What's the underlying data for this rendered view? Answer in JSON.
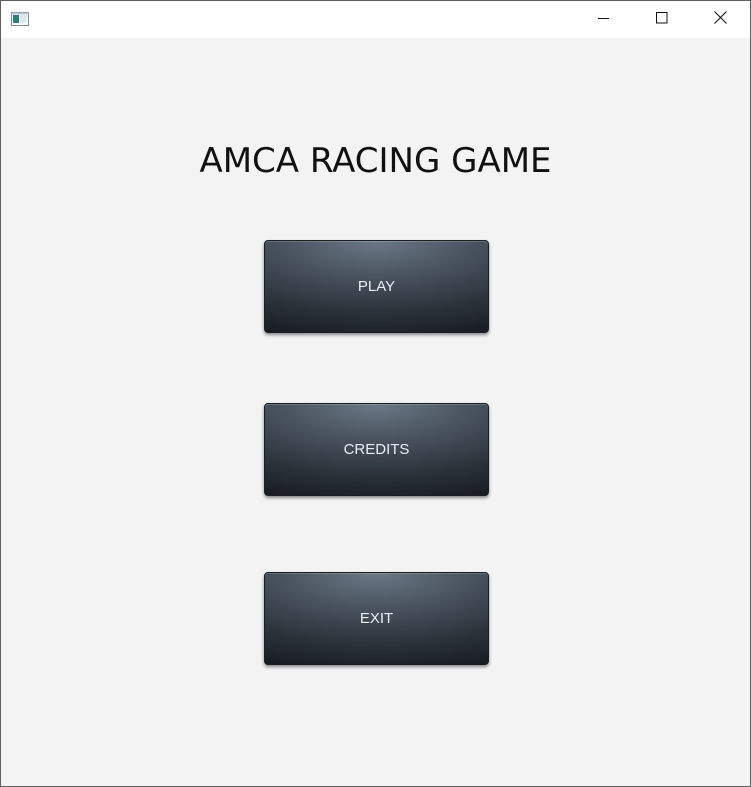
{
  "window": {
    "app_icon": "app-window-icon",
    "controls": {
      "minimize_icon": "minimize-icon",
      "maximize_icon": "maximize-icon",
      "close_icon": "close-icon"
    }
  },
  "main": {
    "title": "AMCA RACING GAME",
    "buttons": {
      "play": "PLAY",
      "credits": "CREDITS",
      "exit": "EXIT"
    }
  },
  "colors": {
    "background": "#f3f3f3",
    "titlebar": "#ffffff",
    "button_top": "#6b7886",
    "button_bottom": "#181c21",
    "button_text": "#e9eef3",
    "title_text": "#111111"
  }
}
